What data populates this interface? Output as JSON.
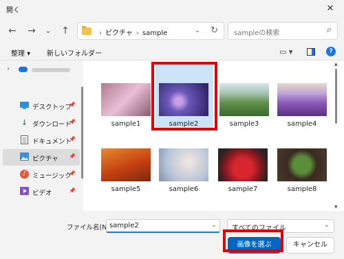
{
  "window": {
    "title": "開く",
    "close_glyph": "✕"
  },
  "nav": {
    "back_glyph": "←",
    "forward_glyph": "→",
    "recent_glyph": "⌄",
    "up_glyph": "↑",
    "breadcrumbs": [
      "ピクチャ",
      "sample"
    ],
    "search_placeholder": "sampleの検索"
  },
  "toolbar": {
    "organize_label": "整理 ▾",
    "new_folder_label": "新しいフォルダー",
    "help_label": "?"
  },
  "sidebar": {
    "items": [
      {
        "label": "デスクトップ",
        "icon": "desktop-icon"
      },
      {
        "label": "ダウンロード",
        "icon": "download-icon",
        "glyph": "↓"
      },
      {
        "label": "ドキュメント",
        "icon": "documents-icon"
      },
      {
        "label": "ピクチャ",
        "icon": "pictures-icon",
        "selected": true
      },
      {
        "label": "ミュージック",
        "icon": "music-icon",
        "glyph": "♪"
      },
      {
        "label": "ビデオ",
        "icon": "videos-icon"
      }
    ]
  },
  "files": [
    {
      "name": "sample1",
      "colors": [
        "#7d5a6a",
        "#d8a6c0"
      ]
    },
    {
      "name": "sample2",
      "colors": [
        "#4f3a8c",
        "#8f7fd0"
      ],
      "selected": true
    },
    {
      "name": "sample3",
      "colors": [
        "#6f9a55",
        "#3c6a38"
      ]
    },
    {
      "name": "sample4",
      "colors": [
        "#b091d2",
        "#6a3f8e"
      ]
    },
    {
      "name": "sample5",
      "colors": [
        "#c8541a",
        "#e8a640"
      ]
    },
    {
      "name": "sample6",
      "colors": [
        "#b8c5d9",
        "#e8d8c8"
      ]
    },
    {
      "name": "sample7",
      "colors": [
        "#3a2c2c",
        "#c7262f"
      ]
    },
    {
      "name": "sample8",
      "colors": [
        "#4d3a2a",
        "#3d6a32"
      ]
    }
  ],
  "footer": {
    "filename_label": "ファイル名(N):",
    "filename_value": "sample2",
    "filetype_value": "すべてのファイル",
    "open_button": "画像を選ぶ",
    "cancel_button": "キャンセル"
  },
  "colors": {
    "accent": "#0067c0",
    "highlight": "#e30000",
    "selection": "#cce4f7"
  }
}
